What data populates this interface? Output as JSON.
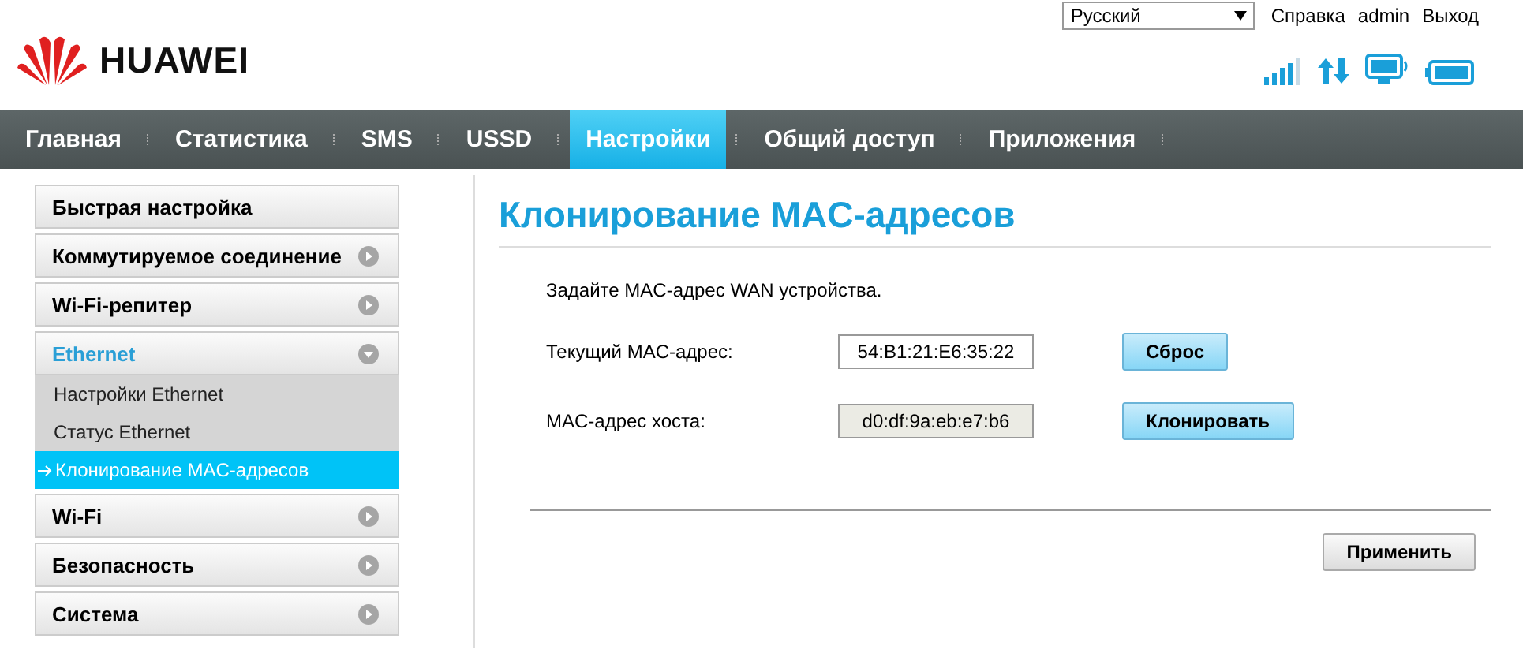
{
  "header": {
    "logo": "HUAWEI",
    "language": "Русский",
    "links": [
      "Справка",
      "admin",
      "Выход"
    ]
  },
  "nav": [
    {
      "label": "Главная",
      "selected": false
    },
    {
      "label": "Статистика",
      "selected": false
    },
    {
      "label": "SMS",
      "selected": false
    },
    {
      "label": "USSD",
      "selected": false
    },
    {
      "label": "Настройки",
      "selected": true
    },
    {
      "label": "Общий доступ",
      "selected": false
    },
    {
      "label": "Приложения",
      "selected": false
    }
  ],
  "sidebar": {
    "items": [
      {
        "kind": "link",
        "label": "Быстрая настройка"
      },
      {
        "kind": "group",
        "label": "Коммутируемое соединение",
        "expanded": false
      },
      {
        "kind": "group",
        "label": "Wi-Fi-репитер",
        "expanded": false
      },
      {
        "kind": "group",
        "label": "Ethernet",
        "expanded": true,
        "children": [
          {
            "label": "Настройки Ethernet",
            "selected": false
          },
          {
            "label": "Статус Ethernet",
            "selected": false
          },
          {
            "label": "Клонирование MAC-адресов",
            "selected": true
          }
        ]
      },
      {
        "kind": "group",
        "label": "Wi-Fi",
        "expanded": false
      },
      {
        "kind": "group",
        "label": "Безопасность",
        "expanded": false
      },
      {
        "kind": "group",
        "label": "Система",
        "expanded": false
      }
    ]
  },
  "content": {
    "title": "Клонирование MAC-адресов",
    "description": "Задайте MAC-адрес WAN устройства.",
    "rows": [
      {
        "label": "Текущий MAC-адрес:",
        "value": "54:B1:21:E6:35:22",
        "disabled": false,
        "button": "Сброс"
      },
      {
        "label": "MAC-адрес хоста:",
        "value": "d0:df:9a:eb:e7:b6",
        "disabled": true,
        "button": "Клонировать"
      }
    ],
    "apply": "Применить"
  }
}
